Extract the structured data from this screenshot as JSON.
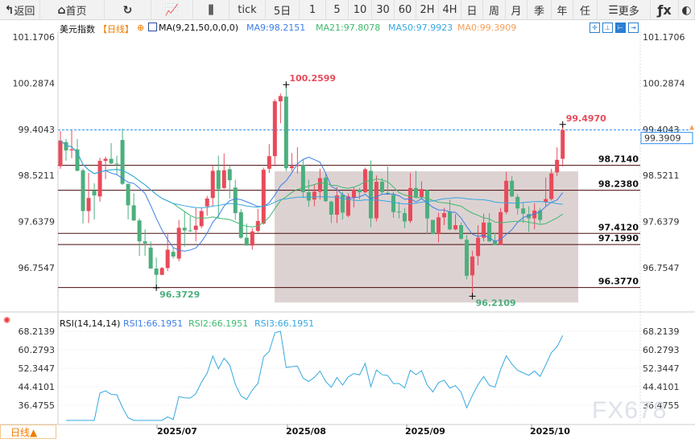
{
  "toolbar": {
    "items": [
      {
        "label": "返回",
        "icon": "back-icon",
        "w": 50
      },
      {
        "label": "首页",
        "icon": "home-icon",
        "w": 80
      },
      {
        "label": "",
        "icon": "refresh-icon",
        "w": 58
      },
      {
        "label": "",
        "icon": "chart-indicator-icon",
        "w": 52
      },
      {
        "label": "",
        "icon": "candlestick-icon",
        "w": 45
      },
      {
        "label": "tick",
        "w": 45
      },
      {
        "label": "5日",
        "w": 42
      },
      {
        "label": "1",
        "w": 33
      },
      {
        "label": "5",
        "w": 28
      },
      {
        "label": "10",
        "w": 29
      },
      {
        "label": "30",
        "w": 28
      },
      {
        "label": "60",
        "w": 27
      },
      {
        "label": "2H",
        "w": 28
      },
      {
        "label": "4H",
        "w": 28
      },
      {
        "label": "日",
        "w": 27
      },
      {
        "label": "周",
        "w": 28
      },
      {
        "label": "月",
        "w": 27
      },
      {
        "label": "季",
        "w": 30
      },
      {
        "label": "年",
        "w": 27
      },
      {
        "label": "任",
        "w": 30
      },
      {
        "label": "更多",
        "icon": "menu-icon",
        "w": 66
      },
      {
        "label": "",
        "icon": "function-fx-icon",
        "w": 35
      },
      {
        "label": "",
        "icon": "settings-icon",
        "w": 20
      }
    ]
  },
  "legend": {
    "symbol": "美元指数",
    "period": "【日线】",
    "ma_params": "MA(9,21,50,0,0,0)",
    "ma9": "MA9:98.2151",
    "ma21": "MA21:97.8078",
    "ma50": "MA50:97.9923",
    "ma0": "MA0:99.3909"
  },
  "rsi_legend": {
    "params": "RSI(14,14,14)",
    "rsi1": "RSI1:66.1951",
    "rsi2": "RSI2:66.1951",
    "rsi3": "RSI3:66.1951"
  },
  "colors": {
    "up": "#e84a5a",
    "down": "#4caf7d",
    "ma9": "#3d7fe6",
    "ma21": "#3fba6e",
    "ma50": "#36a8e0",
    "ma0": "#f5a05a",
    "level": "#4a0a0a",
    "box": "#ddd2d2",
    "rsi": "#36a8e0"
  },
  "price_axis": [
    "101.1706",
    "100.2874",
    "99.4043",
    "98.5211",
    "97.6379",
    "96.7547"
  ],
  "price_axis_values": [
    101.1706,
    100.2874,
    99.4043,
    98.5211,
    97.6379,
    96.7547
  ],
  "current_price": "99.3909",
  "levels": [
    {
      "label": "98.7140",
      "v": 98.714
    },
    {
      "label": "98.2380",
      "v": 98.238
    },
    {
      "label": "97.4120",
      "v": 97.412
    },
    {
      "label": "97.1990",
      "v": 97.199
    },
    {
      "label": "96.3770",
      "v": 96.377
    }
  ],
  "annotations": {
    "high": "100.2599",
    "low1": "96.3729",
    "low2": "96.2109",
    "last_high": "99.4970"
  },
  "rsi_axis": [
    "68.2139",
    "60.2793",
    "52.3447",
    "44.4101",
    "36.4755"
  ],
  "rsi_axis_values": [
    68.2139,
    60.2793,
    52.3447,
    44.4101,
    36.4755
  ],
  "x_axis": [
    "2025/07",
    "2025/08",
    "2025/09",
    "2025/10"
  ],
  "period_button": "日线▲",
  "watermark": "FX678",
  "chart_data": {
    "type": "candlestick",
    "x_labels": [
      "2025/07",
      "2025/08",
      "2025/09",
      "2025/10"
    ],
    "ohlc": [
      [
        98.7,
        99.37,
        98.65,
        99.19
      ],
      [
        99.16,
        99.22,
        98.8,
        99.0
      ],
      [
        99.0,
        99.39,
        98.85,
        99.02
      ],
      [
        99.02,
        99.22,
        98.6,
        98.61
      ],
      [
        98.62,
        98.65,
        97.6,
        97.84
      ],
      [
        97.84,
        98.57,
        97.61,
        98.09
      ],
      [
        98.23,
        98.37,
        97.68,
        98.14
      ],
      [
        98.12,
        98.86,
        98.02,
        98.8
      ],
      [
        98.8,
        98.88,
        98.45,
        98.84
      ],
      [
        98.84,
        99.14,
        98.74,
        98.75
      ],
      [
        98.75,
        98.9,
        98.54,
        98.74
      ],
      [
        99.2,
        99.42,
        98.34,
        98.36
      ],
      [
        98.36,
        98.36,
        97.68,
        97.95
      ],
      [
        97.95,
        98.18,
        97.65,
        97.66
      ],
      [
        97.66,
        97.7,
        96.98,
        97.26
      ],
      [
        97.26,
        97.49,
        96.98,
        97.22
      ],
      [
        97.14,
        97.26,
        96.74,
        96.74
      ],
      [
        96.74,
        96.95,
        96.3729,
        96.62
      ],
      [
        96.62,
        96.77,
        96.61,
        96.75
      ],
      [
        96.75,
        97.42,
        96.69,
        97.1
      ],
      [
        97.06,
        97.14,
        96.93,
        96.97
      ],
      [
        96.93,
        97.67,
        96.88,
        97.52
      ],
      [
        97.52,
        97.83,
        97.16,
        97.47
      ],
      [
        97.47,
        97.74,
        97.44,
        97.46
      ],
      [
        97.48,
        97.9,
        97.26,
        97.56
      ],
      [
        97.55,
        97.9,
        97.51,
        97.84
      ],
      [
        97.93,
        98.13,
        97.75,
        98.08
      ],
      [
        98.09,
        98.7,
        97.94,
        98.61
      ],
      [
        98.62,
        98.9,
        97.7,
        98.26
      ],
      [
        98.28,
        98.94,
        98.26,
        98.62
      ],
      [
        98.64,
        98.7,
        98.08,
        98.43
      ],
      [
        98.29,
        98.44,
        97.67,
        97.8
      ],
      [
        97.82,
        97.88,
        97.31,
        97.33
      ],
      [
        97.33,
        97.6,
        97.18,
        97.18
      ],
      [
        97.18,
        97.51,
        97.1,
        97.45
      ],
      [
        97.46,
        97.88,
        97.43,
        97.65
      ],
      [
        97.6,
        98.67,
        97.58,
        98.63
      ],
      [
        98.65,
        99.12,
        98.57,
        98.89
      ],
      [
        98.89,
        99.98,
        98.7,
        99.94
      ],
      [
        99.94,
        100.09,
        99.52,
        100.04
      ],
      [
        100.03,
        100.2599,
        98.6,
        98.66
      ],
      [
        98.66,
        98.95,
        98.6,
        98.7
      ],
      [
        98.7,
        99.06,
        98.56,
        98.73
      ],
      [
        98.72,
        98.83,
        98.09,
        98.2
      ],
      [
        98.2,
        98.44,
        97.92,
        98.04
      ],
      [
        98.06,
        98.35,
        97.93,
        98.21
      ],
      [
        98.21,
        98.65,
        98.06,
        98.47
      ],
      [
        98.48,
        98.55,
        98.01,
        98.03
      ],
      [
        98.02,
        98.04,
        97.61,
        97.77
      ],
      [
        97.77,
        98.3,
        97.61,
        98.14
      ],
      [
        98.15,
        98.21,
        97.68,
        97.81
      ],
      [
        97.75,
        98.18,
        97.72,
        98.12
      ],
      [
        98.1,
        98.29,
        97.91,
        98.25
      ],
      [
        98.25,
        98.28,
        98.06,
        98.2
      ],
      [
        98.2,
        98.67,
        98.18,
        98.64
      ],
      [
        98.61,
        98.81,
        97.53,
        97.7
      ],
      [
        97.7,
        98.52,
        97.64,
        98.4
      ],
      [
        98.4,
        98.47,
        98.16,
        98.2
      ],
      [
        98.19,
        98.69,
        98.15,
        98.16
      ],
      [
        98.15,
        98.21,
        97.71,
        97.82
      ],
      [
        97.83,
        98.01,
        97.7,
        97.82
      ],
      [
        97.8,
        97.9,
        97.51,
        97.64
      ],
      [
        97.65,
        98.57,
        97.61,
        98.28
      ],
      [
        98.28,
        98.61,
        98.09,
        98.11
      ],
      [
        98.11,
        98.41,
        98.06,
        98.26
      ],
      [
        98.24,
        98.25,
        97.41,
        97.7
      ],
      [
        97.67,
        97.67,
        97.4,
        97.4
      ],
      [
        97.4,
        97.81,
        97.24,
        97.72
      ],
      [
        97.72,
        97.9,
        97.57,
        97.8
      ],
      [
        97.83,
        98.06,
        97.47,
        97.49
      ],
      [
        97.49,
        97.78,
        97.47,
        97.57
      ],
      [
        97.57,
        97.62,
        97.29,
        97.31
      ],
      [
        97.29,
        97.38,
        96.53,
        96.6
      ],
      [
        96.61,
        97.08,
        96.2109,
        96.97
      ],
      [
        96.98,
        97.57,
        96.8,
        97.33
      ],
      [
        97.33,
        97.79,
        97.26,
        97.62
      ],
      [
        97.62,
        97.8,
        97.25,
        97.26
      ],
      [
        97.27,
        97.42,
        97.19,
        97.19
      ],
      [
        97.19,
        97.9,
        97.19,
        97.82
      ],
      [
        97.82,
        98.59,
        97.78,
        98.42
      ],
      [
        98.42,
        98.51,
        98.11,
        98.12
      ],
      [
        98.11,
        98.16,
        97.77,
        97.89
      ],
      [
        97.89,
        98.01,
        97.61,
        97.79
      ],
      [
        97.78,
        97.93,
        97.44,
        97.7
      ],
      [
        97.7,
        97.99,
        97.49,
        97.85
      ],
      [
        97.85,
        97.9,
        97.6,
        97.67
      ],
      [
        98.01,
        98.48,
        97.94,
        98.07
      ],
      [
        98.07,
        98.65,
        98.04,
        98.56
      ],
      [
        98.58,
        99.06,
        98.51,
        98.82
      ],
      [
        98.84,
        99.497,
        98.69,
        99.3909
      ]
    ],
    "ma_periods": [
      9,
      21,
      50
    ],
    "rsi_period": 14
  }
}
